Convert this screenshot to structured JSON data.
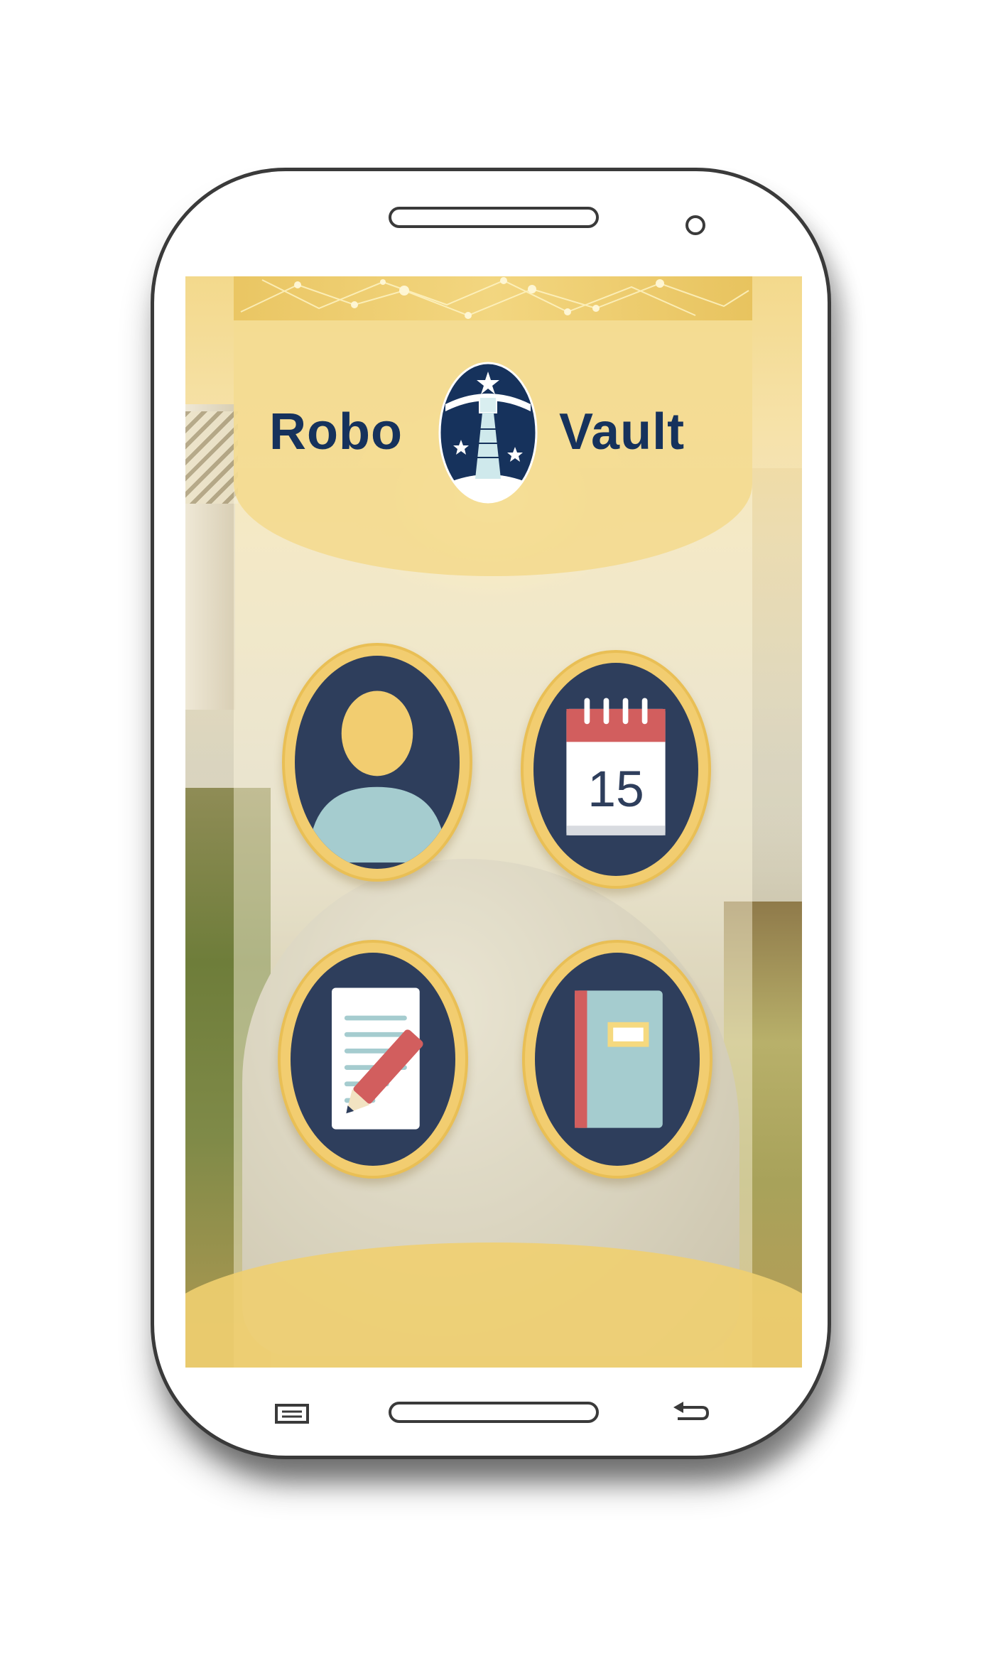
{
  "app": {
    "name_left": "Robo",
    "name_right": "Vault"
  },
  "tiles": [
    {
      "id": "profile",
      "icon": "user-profile-icon"
    },
    {
      "id": "calendar",
      "icon": "calendar-icon",
      "day": "15"
    },
    {
      "id": "notes",
      "icon": "note-pencil-icon"
    },
    {
      "id": "journal",
      "icon": "notebook-icon"
    }
  ],
  "device": {
    "nav_keys": [
      "menu-key",
      "home-button",
      "back-key"
    ]
  },
  "colors": {
    "brand_navy": "#16325c",
    "tile_gold": "#f2cd70",
    "tile_dark": "#2e3e5c",
    "avatar_head": "#f2cd70",
    "avatar_body": "#a5cccf",
    "calendar_red": "#d25e5e",
    "pencil_red": "#d25e5e",
    "notebook_cover": "#a5cccf"
  }
}
